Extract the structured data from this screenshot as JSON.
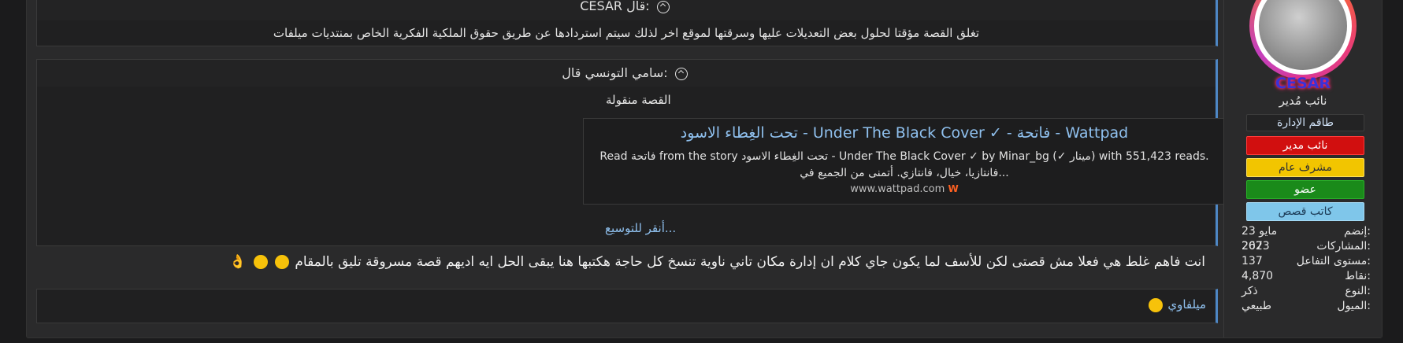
{
  "sidebar": {
    "username": "CESAR",
    "user_title": "نائب مُدير",
    "badges": {
      "staff": "طاقم الإدارة",
      "deputy": "نائب مدير",
      "general": "مشرف عام",
      "member": "عضو",
      "writer": "كاتب قصص"
    },
    "stats": [
      {
        "key": "إنضم:",
        "value": "23 مايو 2023"
      },
      {
        "key": "المشاركات:",
        "value": "267"
      },
      {
        "key": "مستوى التفاعل:",
        "value": "137"
      },
      {
        "key": "نقاط:",
        "value": "4,870"
      },
      {
        "key": "النوع:",
        "value": "ذكر"
      },
      {
        "key": "الميول:",
        "value": "طبيعي"
      }
    ]
  },
  "quotes": [
    {
      "header": "CESAR قال:",
      "text": "تغلق القصة مؤقتا لحلول بعض التعديلات عليها وسرقتها لموقع اخر لذلك سيتم استردادها عن طريق حقوق الملكية الفكرية الخاص بمنتديات ميلفات"
    },
    {
      "header": "سامي التونسي قال:",
      "text": "القصة منقولة"
    }
  ],
  "link_card": {
    "title": "تحت الغِطاء الاسود - Under The Black Cover ✓ - فاتحة - Wattpad",
    "description_line1": "Read فاتحة from the story تحت الغِطاء الاسود - Under The Black Cover ✓ by Minar_bg (✓ مينار) with 551,423 reads.",
    "description_line2": "فانتازيا، خيال، فانتازي. أتمنى من الجميع في...",
    "domain": "www.wattpad.com"
  },
  "expand_label": "أنقر للتوسيع...",
  "post_body": "انت فاهم غلط هي فعلا مش قصتى لكن للأسف لما يكون جاي كلام ان إدارة مكان تاني ناوية تنسخ كل حاجة هكتبها هنا يبقى الحل ايه اديهم قصة مسروقة تليق بالمقام",
  "signature": "ميلفاوي"
}
